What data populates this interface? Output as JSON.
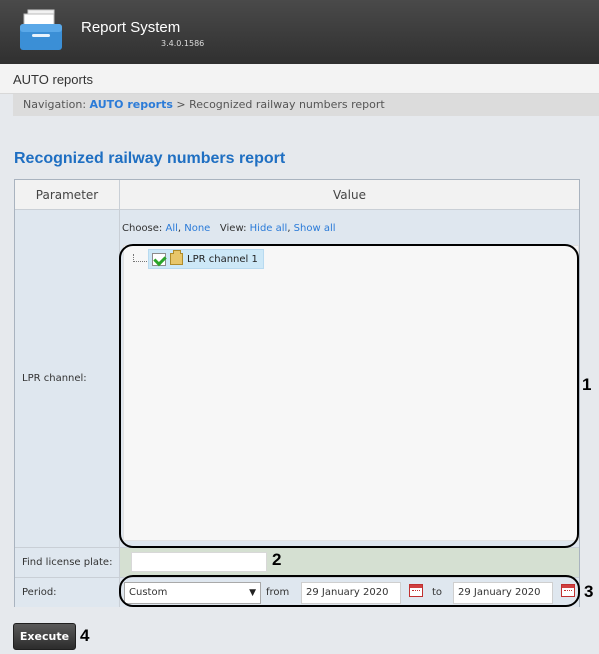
{
  "header": {
    "app_title": "Report System",
    "version": "3.4.0.1586",
    "logo_icon": "report-folder-icon"
  },
  "section": {
    "title": "AUTO reports"
  },
  "navigation": {
    "prefix": "Navigation:",
    "link": "AUTO reports",
    "separator": ">",
    "current": "Recognized railway numbers report"
  },
  "report": {
    "title": "Recognized railway numbers report",
    "columns": {
      "parameter": "Parameter",
      "value": "Value"
    },
    "lpr_channel": {
      "label": "LPR channel:",
      "choose_label": "Choose:",
      "choose_all": "All",
      "choose_none": "None",
      "view_label": "View:",
      "hide_all": "Hide all",
      "show_all": "Show all",
      "tree": [
        {
          "label": "LPR channel 1",
          "checked": true,
          "icon": "folder-icon"
        }
      ]
    },
    "find_plate": {
      "label": "Find license plate:",
      "value": ""
    },
    "period": {
      "label": "Period:",
      "selected": "Custom",
      "from_label": "from",
      "from_date": "29 January 2020",
      "to_label": "to",
      "to_date": "29 January 2020"
    }
  },
  "actions": {
    "execute": "Execute"
  },
  "callouts": {
    "one": "1",
    "two": "2",
    "three": "3",
    "four": "4"
  }
}
